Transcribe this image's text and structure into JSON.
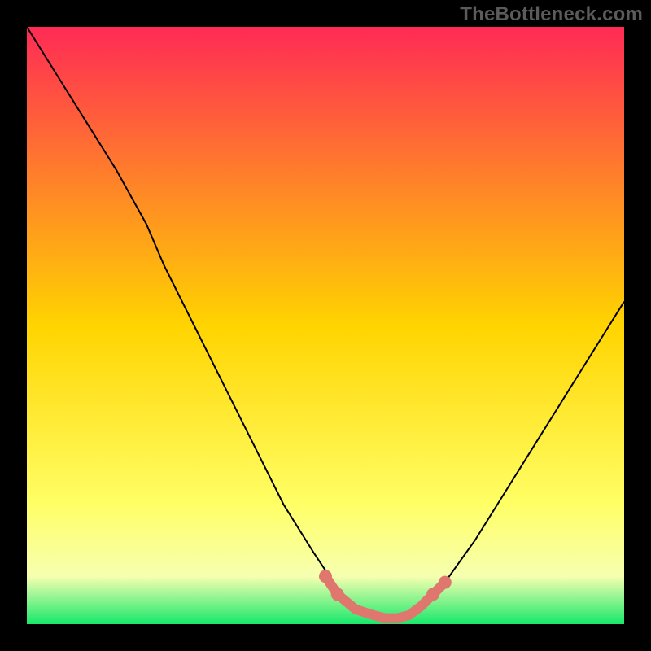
{
  "watermark": {
    "text": "TheBottleneck.com"
  },
  "chart_data": {
    "type": "line",
    "title": "",
    "xlabel": "",
    "ylabel": "",
    "xlim": [
      0,
      100
    ],
    "ylim": [
      0,
      100
    ],
    "grid": false,
    "legend": false,
    "background_gradient": {
      "stops": [
        {
          "offset": 0.0,
          "color": "#ff2a55"
        },
        {
          "offset": 0.5,
          "color": "#ffd400"
        },
        {
          "offset": 0.8,
          "color": "#ffff66"
        },
        {
          "offset": 0.92,
          "color": "#f6ffb0"
        },
        {
          "offset": 1.0,
          "color": "#17e86b"
        }
      ]
    },
    "series": [
      {
        "name": "curve",
        "color": "#000000",
        "x": [
          0,
          5,
          10,
          15,
          20,
          23,
          28,
          33,
          38,
          43,
          48,
          52,
          55,
          58,
          60,
          62,
          64,
          66,
          70,
          75,
          80,
          85,
          90,
          95,
          100
        ],
        "y": [
          100,
          92,
          84,
          76,
          67,
          60,
          50,
          40,
          30,
          20,
          12,
          6,
          3,
          1.5,
          1,
          1,
          1.5,
          3,
          7,
          14,
          22,
          30,
          38,
          46,
          54
        ]
      }
    ],
    "marker_region": {
      "name": "valley-markers",
      "color": "#e0776f",
      "points": [
        {
          "x": 50,
          "y": 8
        },
        {
          "x": 52,
          "y": 5
        },
        {
          "x": 55,
          "y": 2.5
        },
        {
          "x": 58,
          "y": 1.5
        },
        {
          "x": 60,
          "y": 1
        },
        {
          "x": 62,
          "y": 1
        },
        {
          "x": 64,
          "y": 1.5
        },
        {
          "x": 66,
          "y": 3
        },
        {
          "x": 68,
          "y": 5
        },
        {
          "x": 70,
          "y": 7
        }
      ]
    }
  }
}
